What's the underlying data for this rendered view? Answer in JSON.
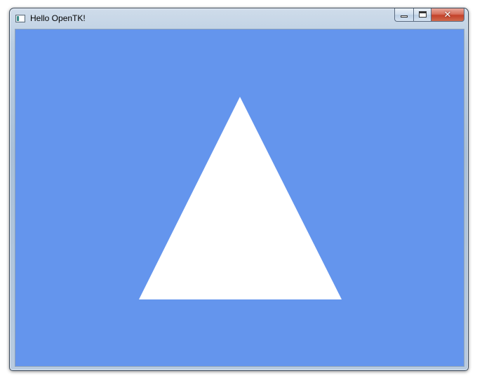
{
  "window": {
    "title": "Hello OpenTK!",
    "icon": "app-window-icon"
  },
  "caption_buttons": {
    "minimize_icon": "minimize-icon",
    "maximize_icon": "maximize-icon",
    "close_icon": "close-icon",
    "close_glyph": "✕"
  },
  "viewport": {
    "clear_color": "#6495ed",
    "triangle_color": "#ffffff"
  }
}
